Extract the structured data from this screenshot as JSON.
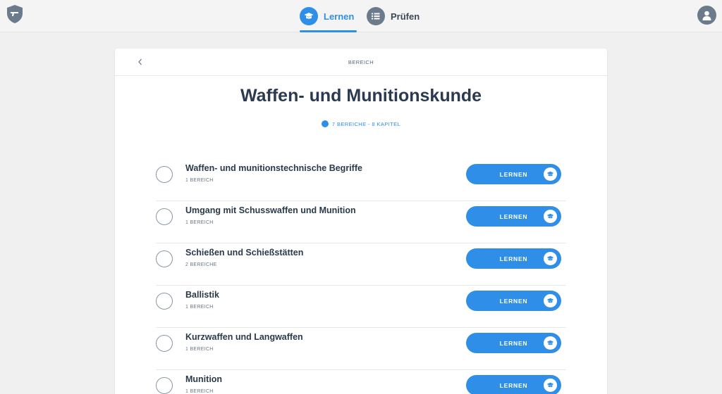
{
  "nav": {
    "tabs": [
      {
        "label": "Lernen",
        "icon": "graduation-cap-icon",
        "active": true
      },
      {
        "label": "Prüfen",
        "icon": "list-icon",
        "active": false
      }
    ]
  },
  "card": {
    "header_label": "BEREICH",
    "title": "Waffen- und Munitionskunde",
    "meta": "7 BEREICHE - 8 KAPITEL"
  },
  "items": [
    {
      "title": "Waffen- und munitionstechnische Begriffe",
      "sub": "1 BEREICH",
      "button": "LERNEN"
    },
    {
      "title": "Umgang mit Schusswaffen und Munition",
      "sub": "1 BEREICH",
      "button": "LERNEN"
    },
    {
      "title": "Schießen und Schießstätten",
      "sub": "2 BEREICHE",
      "button": "LERNEN"
    },
    {
      "title": "Ballistik",
      "sub": "1 BEREICH",
      "button": "LERNEN"
    },
    {
      "title": "Kurzwaffen und Langwaffen",
      "sub": "1 BEREICH",
      "button": "LERNEN"
    },
    {
      "title": "Munition",
      "sub": "1 BEREICH",
      "button": "LERNEN"
    }
  ],
  "colors": {
    "accent": "#2f8fe8",
    "muted_icon": "#6c7b8c",
    "title": "#2b3a50",
    "background": "#f0f0f0"
  }
}
